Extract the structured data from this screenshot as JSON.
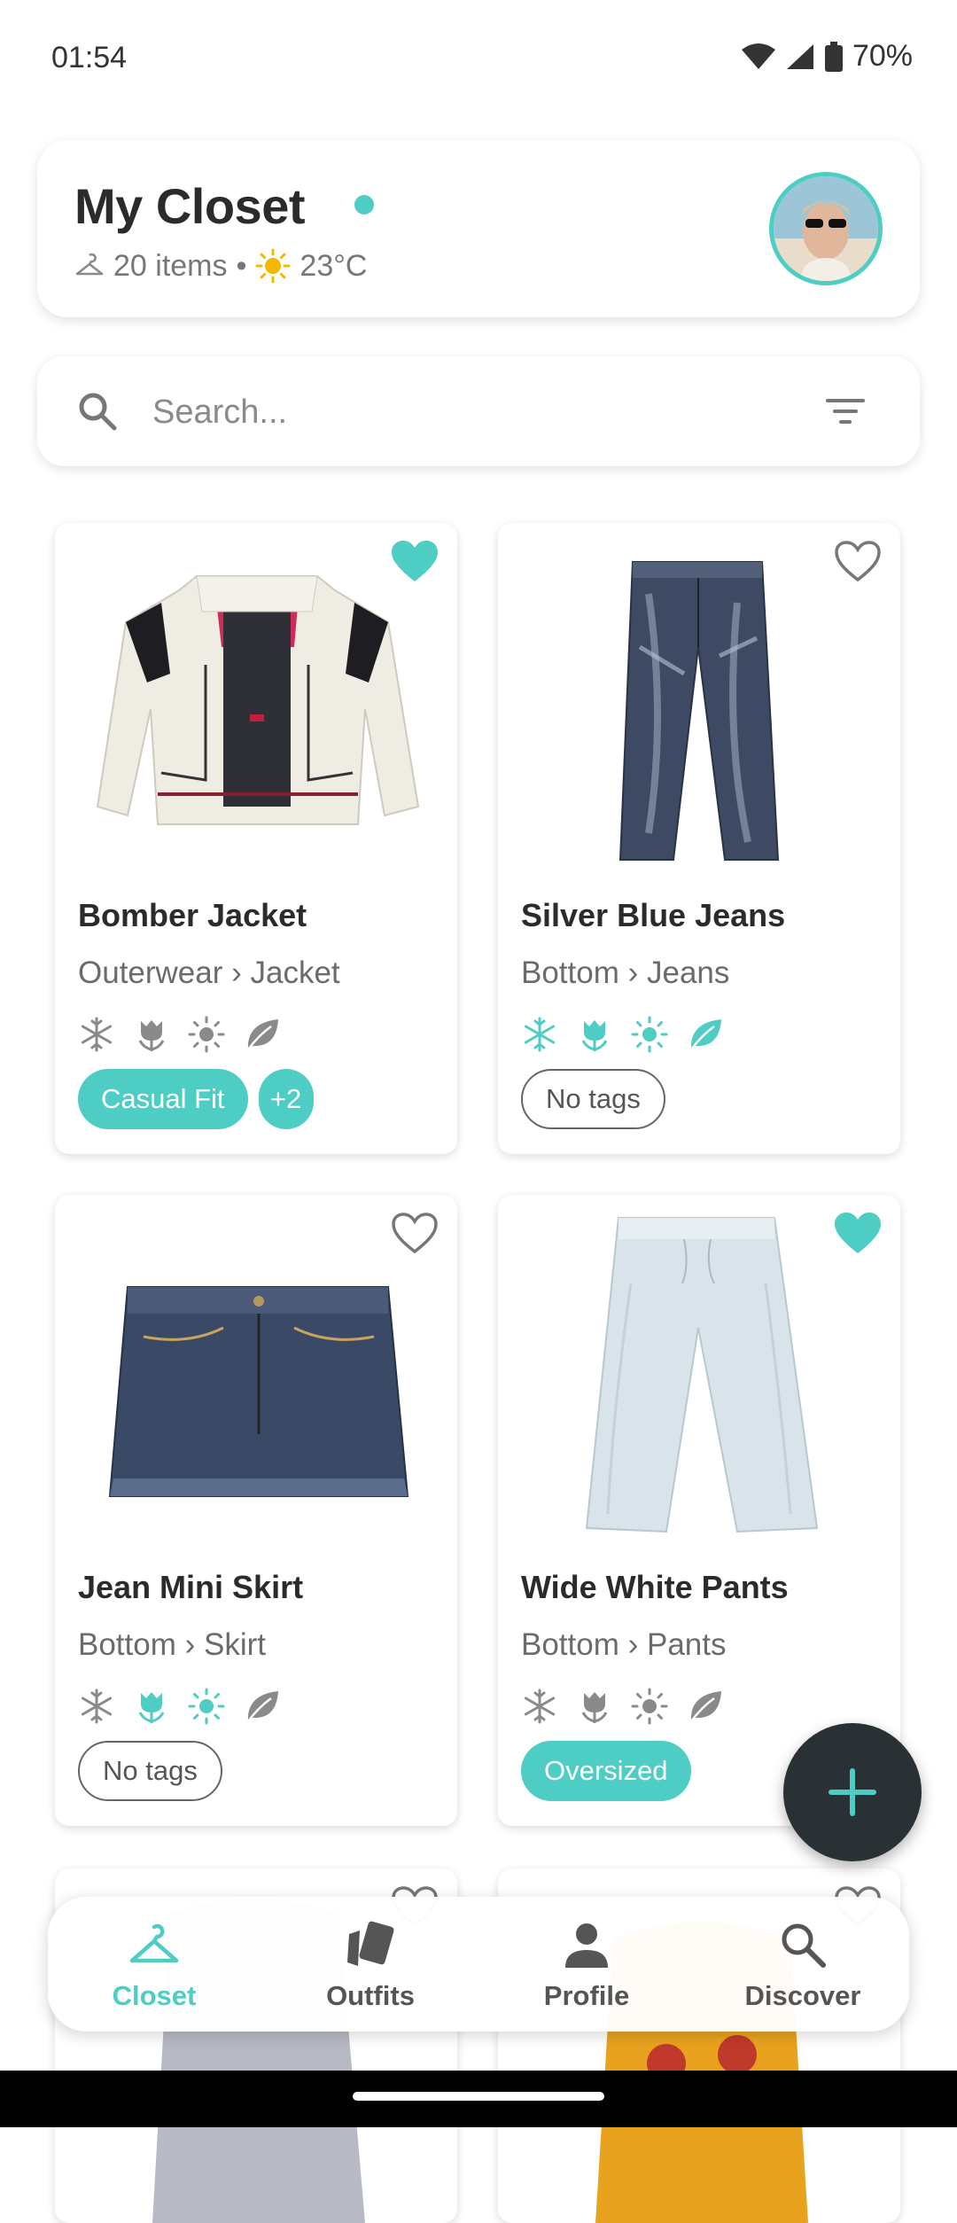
{
  "status_bar": {
    "time": "01:54",
    "battery": "70%"
  },
  "header": {
    "title": "My Closet",
    "items_count": "20 items",
    "separator": "•",
    "temperature": "23°C"
  },
  "search": {
    "placeholder": "Search..."
  },
  "items": [
    {
      "name": "Bomber Jacket",
      "category": "Outerwear › Jacket",
      "favorite": true,
      "seasons": {
        "winter": false,
        "spring": false,
        "summer": false,
        "autumn": false
      },
      "tags": [
        "Casual Fit"
      ],
      "extra_tags": "+2"
    },
    {
      "name": "Silver Blue Jeans",
      "category": "Bottom › Jeans",
      "favorite": false,
      "seasons": {
        "winter": true,
        "spring": true,
        "summer": true,
        "autumn": true
      },
      "no_tags_label": "No tags"
    },
    {
      "name": "Jean Mini Skirt",
      "category": "Bottom › Skirt",
      "favorite": false,
      "seasons": {
        "winter": false,
        "spring": true,
        "summer": true,
        "autumn": false
      },
      "no_tags_label": "No tags"
    },
    {
      "name": "Wide White Pants",
      "category": "Bottom › Pants",
      "favorite": true,
      "seasons": {
        "winter": false,
        "spring": false,
        "summer": false,
        "autumn": false
      },
      "tags": [
        "Oversized"
      ]
    }
  ],
  "nav": {
    "closet": "Closet",
    "outfits": "Outfits",
    "profile": "Profile",
    "discover": "Discover"
  },
  "colors": {
    "accent": "#4ecdc4",
    "fab": "#2a3134",
    "muted_icon": "#8a8a8a"
  }
}
